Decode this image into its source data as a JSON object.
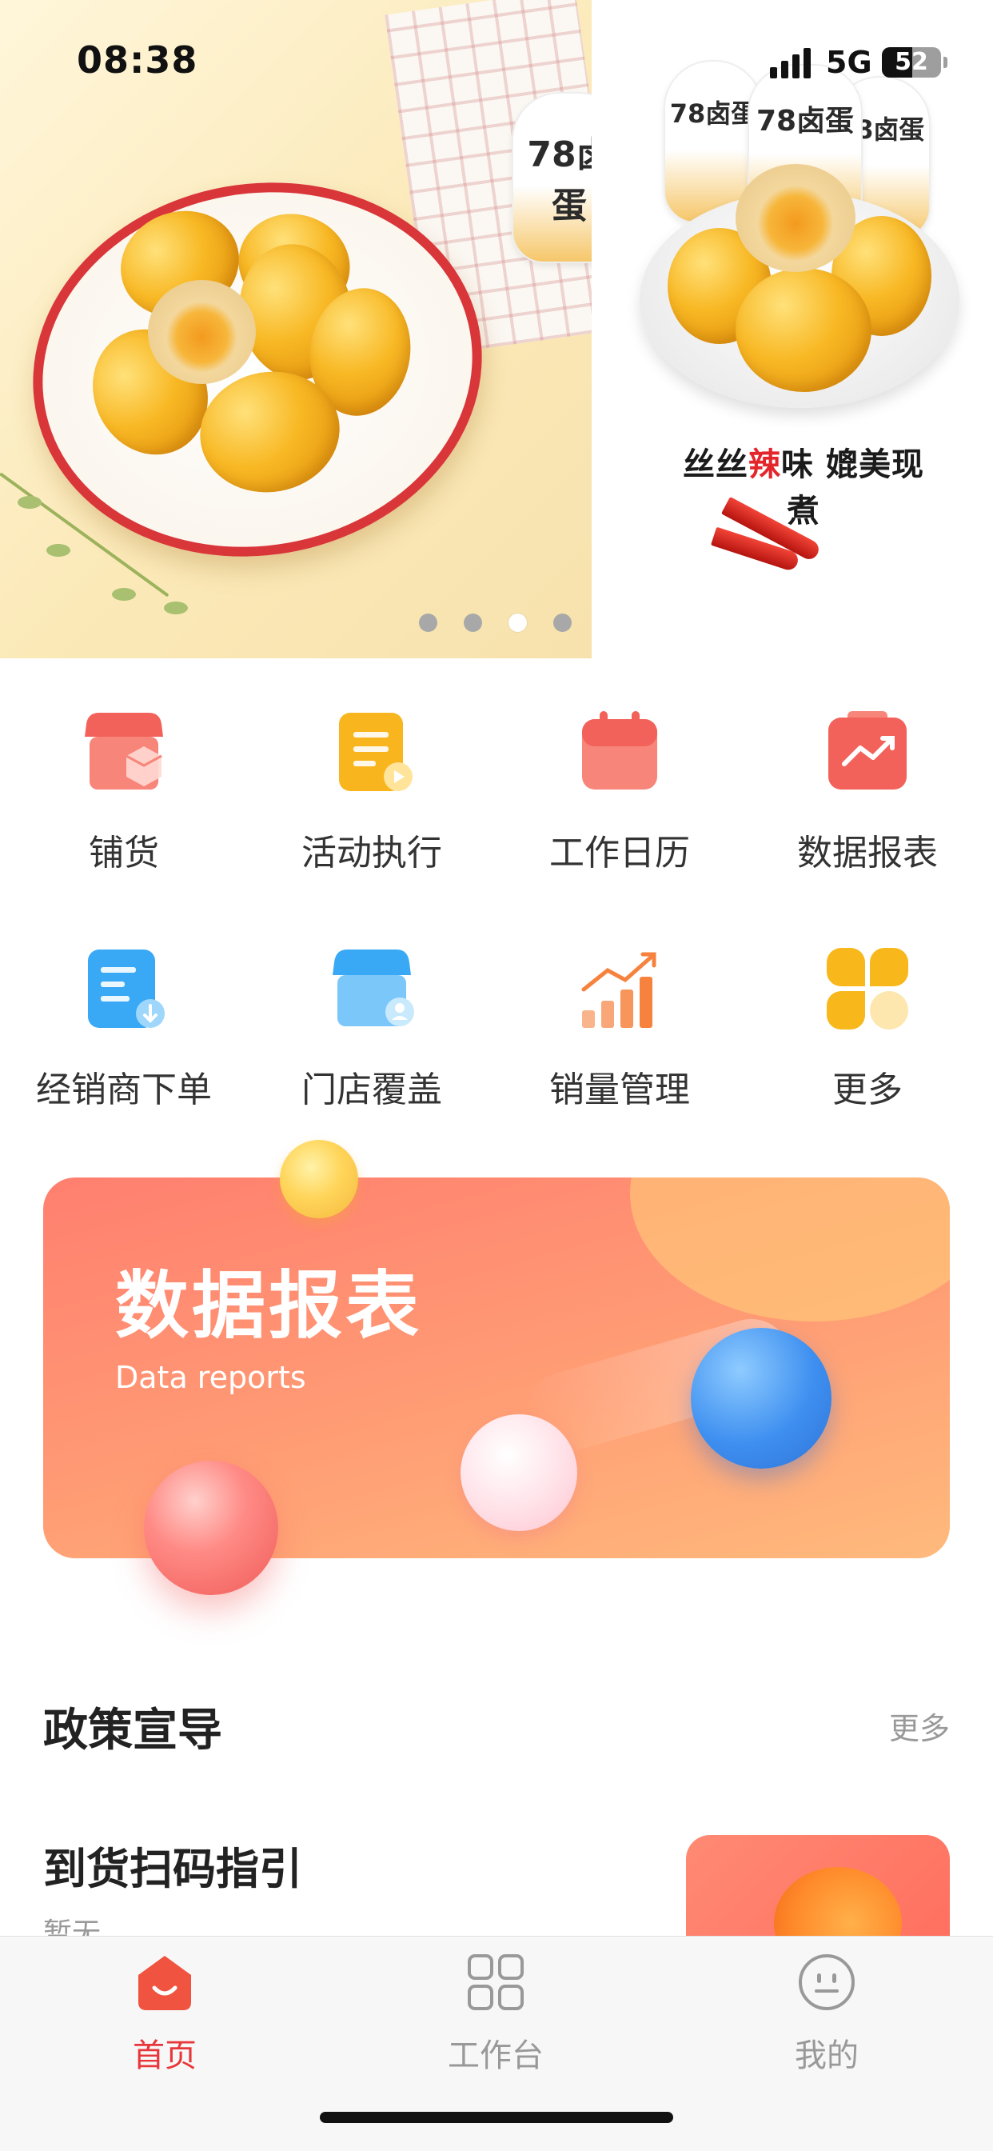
{
  "status_bar": {
    "time": "08:38",
    "network": "5G",
    "battery": "52"
  },
  "banner": {
    "slogan_prefix": "丝丝",
    "slogan_hot": "辣",
    "slogan_suffix": "味 媲美现煮",
    "pack_label": "78卤蛋",
    "indicator_count": 4,
    "active_index": 2
  },
  "quick_menu": {
    "items": [
      {
        "label": "铺货",
        "icon": "store-box-icon",
        "color": "#f2625a"
      },
      {
        "label": "活动执行",
        "icon": "document-play-icon",
        "color": "#f9b51e"
      },
      {
        "label": "工作日历",
        "icon": "calendar-icon",
        "color": "#f46b62"
      },
      {
        "label": "数据报表",
        "icon": "chart-board-icon",
        "color": "#f2625a"
      },
      {
        "label": "经销商下单",
        "icon": "order-download-icon",
        "color": "#3aa9f5"
      },
      {
        "label": "门店覆盖",
        "icon": "store-person-icon",
        "color": "#47b2f4"
      },
      {
        "label": "销量管理",
        "icon": "sales-bars-icon",
        "color": "#f6823e"
      },
      {
        "label": "更多",
        "icon": "more-petals-icon",
        "color": "#f8b81c"
      }
    ]
  },
  "promo": {
    "title": "数据报表",
    "subtitle": "Data reports"
  },
  "policy": {
    "title": "政策宣导",
    "more": "更多",
    "article": {
      "title": "到货扫码指引",
      "desc": "暂无"
    }
  },
  "tabs": [
    {
      "label": "首页",
      "icon": "home-smile-icon",
      "active": true
    },
    {
      "label": "工作台",
      "icon": "grid-icon",
      "active": false
    },
    {
      "label": "我的",
      "icon": "face-icon",
      "active": false
    }
  ],
  "colors": {
    "accent": "#e8373a",
    "inactive": "#999999"
  }
}
